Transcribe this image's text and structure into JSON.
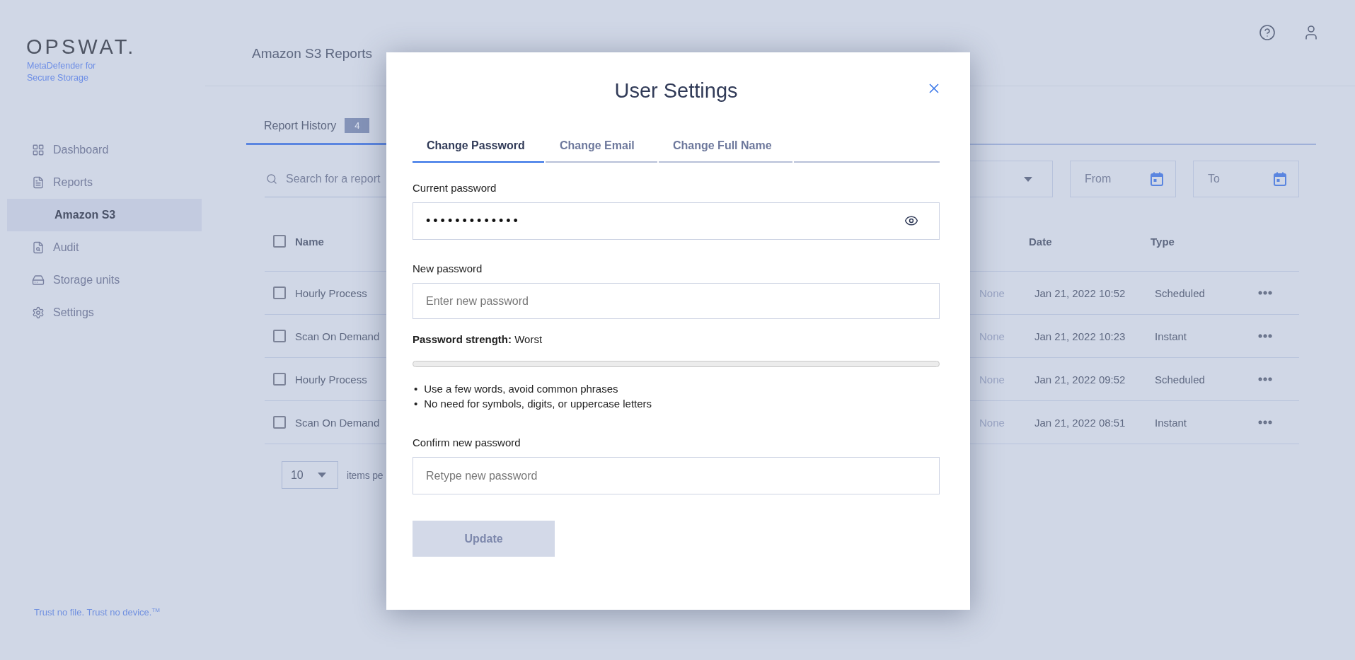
{
  "sidebar": {
    "logo": "OPSWAT.",
    "product": [
      "MetaDefender for",
      "Secure Storage"
    ],
    "items": [
      {
        "label": "Dashboard",
        "selected": false
      },
      {
        "label": "Reports",
        "selected": false,
        "children": [
          {
            "label": "Amazon S3",
            "selected": true
          }
        ]
      },
      {
        "label": "Audit",
        "selected": false
      },
      {
        "label": "Storage units",
        "selected": false
      },
      {
        "label": "Settings",
        "selected": false
      }
    ],
    "footer": "Trust no file. Trust no device.$^{TM}$"
  },
  "header": {
    "breadcrumb": "Amazon S3 Reports"
  },
  "tabs": [
    {
      "label": "Report History",
      "count": "4",
      "selected": true
    }
  ],
  "filters": {
    "search_placeholder": "Search for a report",
    "from_placeholder": "From",
    "to_placeholder": "To"
  },
  "table": {
    "header_checked": false,
    "columns": [
      "Name",
      "Date",
      "Type"
    ],
    "rows": [
      {
        "checked": false,
        "name": "Hourly Process",
        "column_2": "None",
        "date": "Jan 21, 2022 10:52",
        "type": "Scheduled"
      },
      {
        "checked": false,
        "name": "Scan On Demand",
        "column_2": "None",
        "date": "Jan 21, 2022 10:23",
        "type": "Instant"
      },
      {
        "checked": false,
        "name": "Hourly Process",
        "column_2": "None",
        "date": "Jan 21, 2022 09:52",
        "type": "Scheduled"
      },
      {
        "checked": false,
        "name": "Scan On Demand",
        "column_2": "None",
        "date": "Jan 21, 2022 08:51",
        "type": "Instant"
      }
    ]
  },
  "pagination": {
    "page_size": "10",
    "label": "items pe"
  },
  "modal": {
    "title": "User Settings",
    "tabs": [
      {
        "label": "Change Password",
        "selected": true
      },
      {
        "label": "Change Email",
        "selected": false
      },
      {
        "label": "Change Full Name",
        "selected": false
      }
    ],
    "current_password": {
      "label": "Current password",
      "value": "•••••••••••••"
    },
    "new_password": {
      "label": "New password",
      "placeholder": "Enter new password"
    },
    "strength": {
      "text": "**Password strength:** Worst",
      "level": 0
    },
    "hints": [
      {
        "bullet": "•",
        "text": "Use a few words, avoid common phrases"
      },
      {
        "bullet": "•",
        "text": "No need for symbols, digits, or uppercase letters"
      }
    ],
    "confirm_password": {
      "label": "Confirm new password",
      "placeholder": "Retype new password"
    },
    "submit": {
      "label": "Update",
      "disabled": true
    }
  }
}
